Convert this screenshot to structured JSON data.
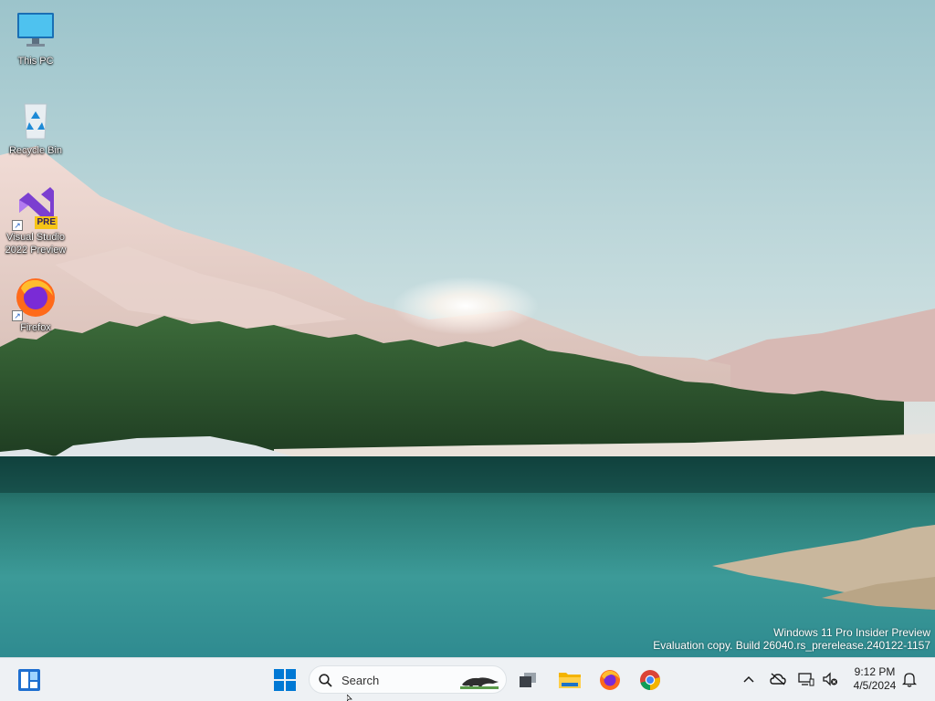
{
  "desktop": {
    "icons": [
      {
        "label": "This PC",
        "icon": "this-pc-icon"
      },
      {
        "label": "Recycle Bin",
        "icon": "recycle-bin-icon"
      },
      {
        "label": "Visual Studio 2022 Preview",
        "icon": "visual-studio-icon",
        "badge": "PRE",
        "shortcut": true
      },
      {
        "label": "Firefox",
        "icon": "firefox-icon",
        "shortcut": true
      }
    ]
  },
  "watermark": {
    "line1": "Windows 11 Pro Insider Preview",
    "line2": "Evaluation copy. Build 26040.rs_prerelease.240122-1157"
  },
  "taskbar": {
    "widgets_icon": "widgets-icon",
    "start_icon": "windows-start-icon",
    "search": {
      "label": "Search",
      "icon": "search-icon"
    },
    "pinned": [
      {
        "name": "task-view",
        "icon": "task-view-icon"
      },
      {
        "name": "file-explorer",
        "icon": "folder-icon"
      },
      {
        "name": "firefox",
        "icon": "firefox-icon"
      },
      {
        "name": "chrome",
        "icon": "chrome-icon"
      }
    ],
    "tray": [
      "chevron-up-icon",
      "onedrive-icon",
      "network-icon",
      "volume-muted-icon",
      "notification-bell-icon"
    ],
    "clock": {
      "time": "9:12 PM",
      "date": "4/5/2024"
    }
  },
  "colors": {
    "taskbar_bg": "#eef1f4",
    "accent_blue": "#0067c0",
    "water": "#2e8a8c"
  }
}
